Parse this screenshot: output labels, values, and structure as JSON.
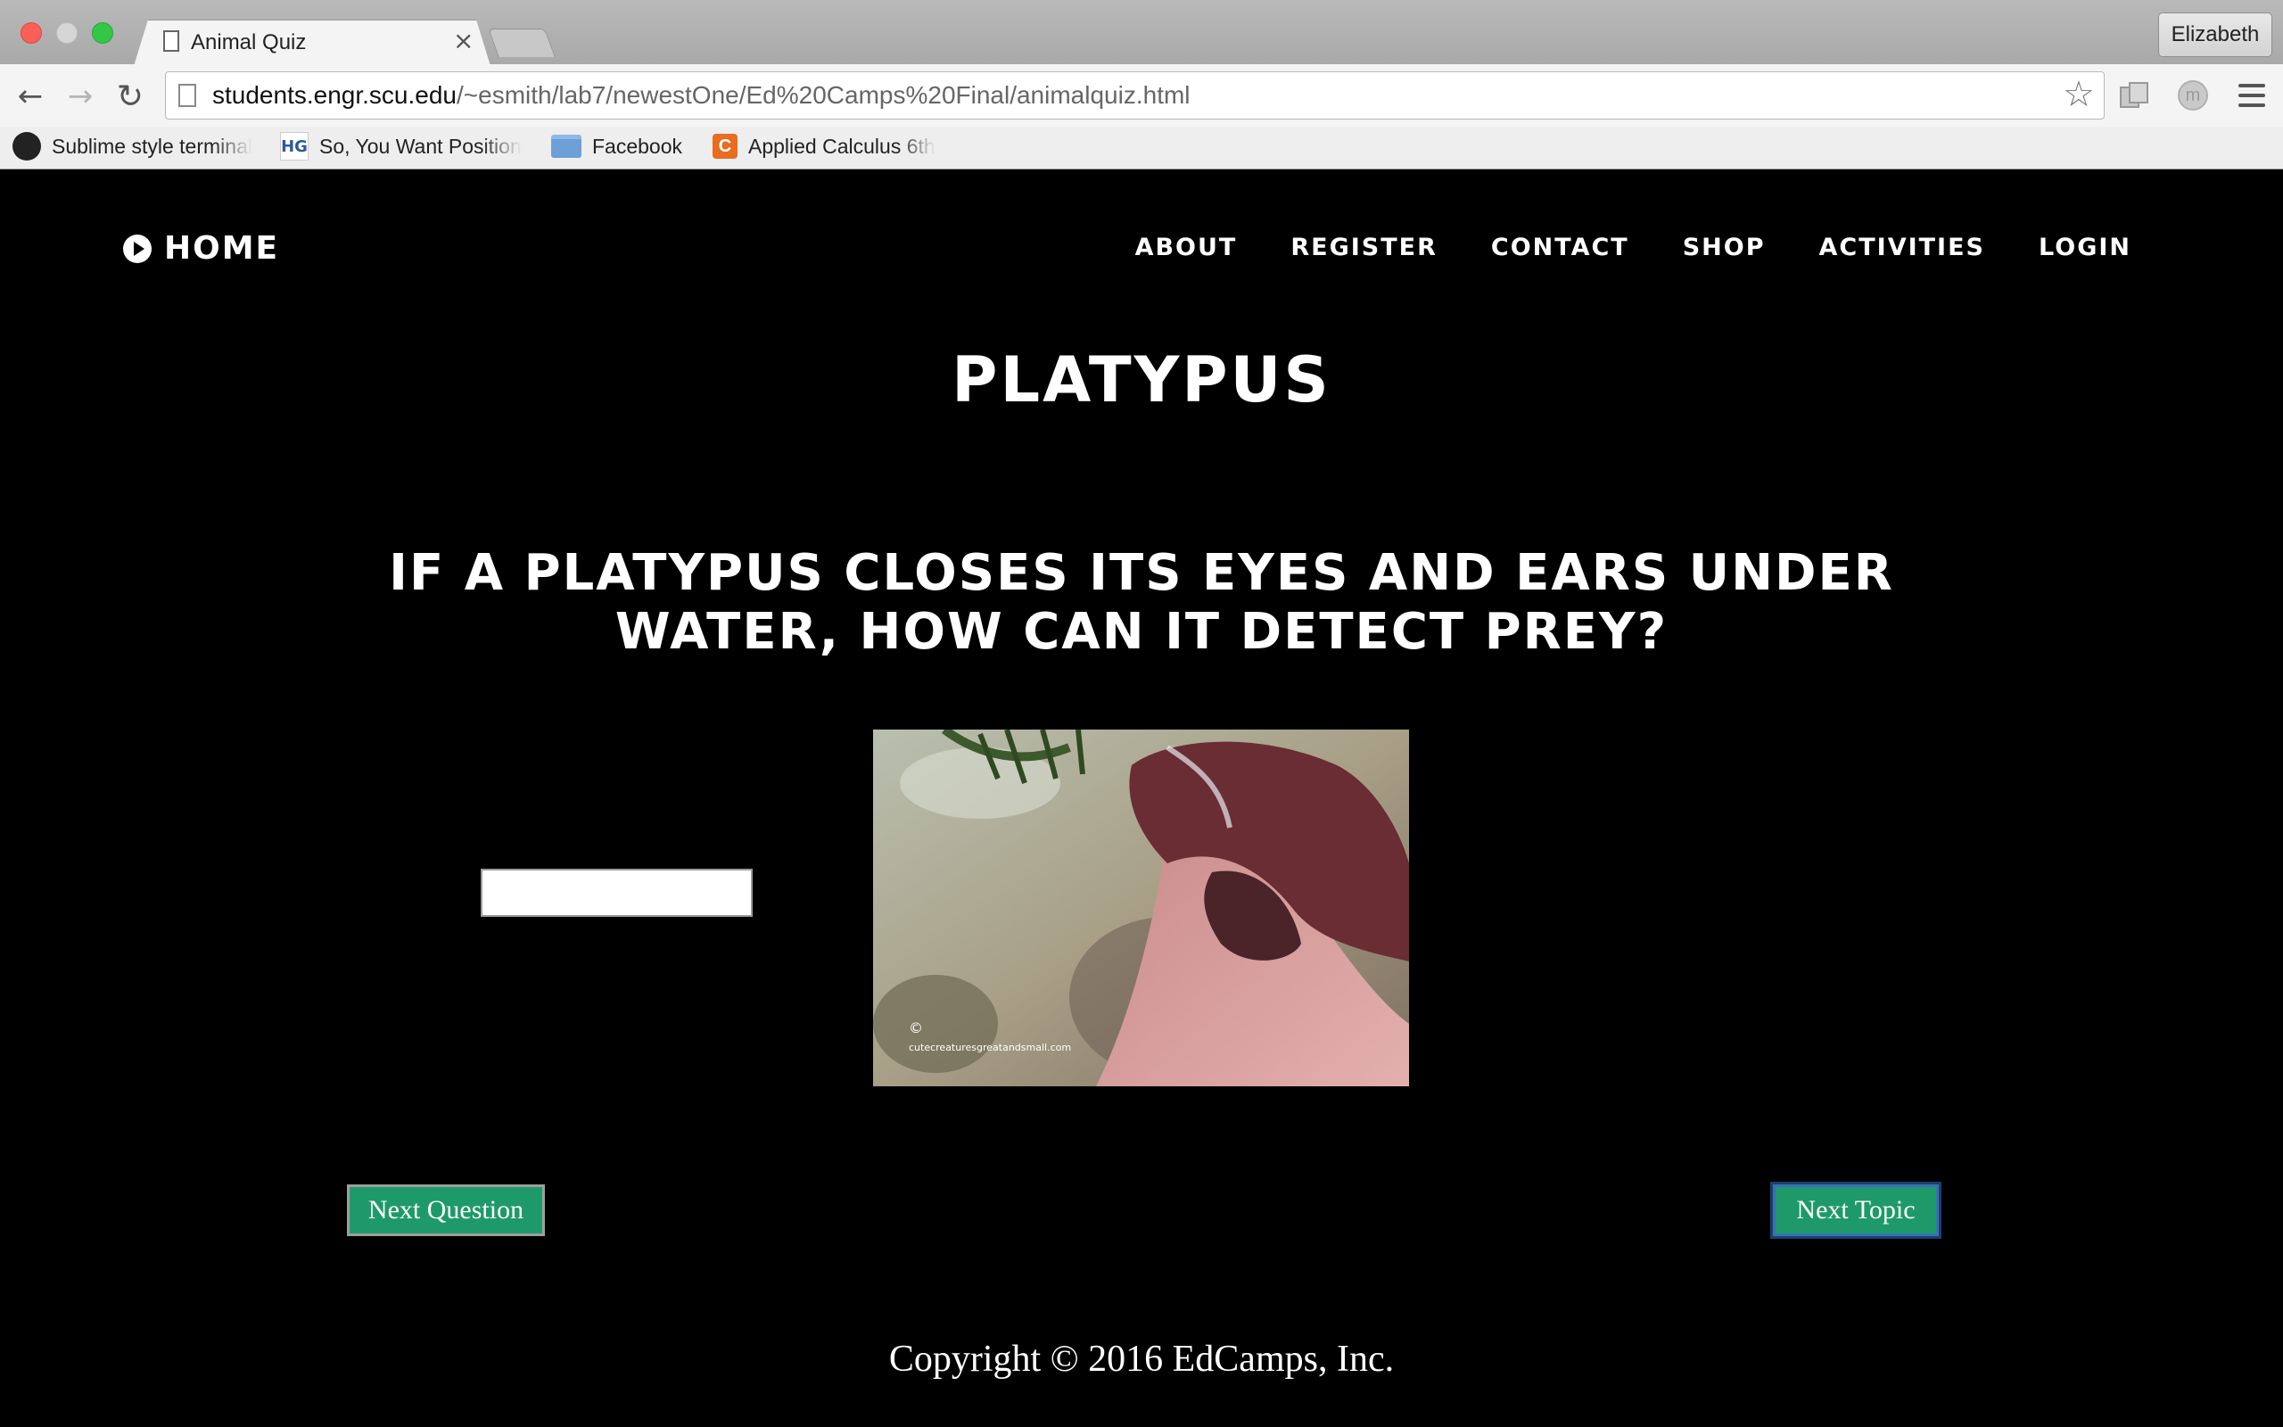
{
  "browser": {
    "tab": {
      "title": "Animal Quiz",
      "close_glyph": "×"
    },
    "profile_name": "Elizabeth",
    "url": {
      "host": "students.engr.scu.edu",
      "path": "/~esmith/lab7/newestOne/Ed%20Camps%20Final/animalquiz.html"
    },
    "nav_glyphs": {
      "back": "←",
      "forward": "→",
      "reload": "↻",
      "star": "☆"
    },
    "bookmarks": [
      {
        "label": "Sublime style terminal",
        "icon": "github-icon"
      },
      {
        "label": "So, You Want Position",
        "icon": "hg-icon",
        "icon_text": "HG"
      },
      {
        "label": "Facebook",
        "icon": "folder-icon"
      },
      {
        "label": "Applied Calculus 6th",
        "icon": "calc-icon",
        "icon_text": "C"
      }
    ]
  },
  "site": {
    "home_label": "HOME",
    "nav": [
      "ABOUT",
      "REGISTER",
      "CONTACT",
      "SHOP",
      "ACTIVITIES",
      "LOGIN"
    ]
  },
  "quiz": {
    "title": "PLATYPUS",
    "question": "IF A PLATYPUS CLOSES ITS EYES AND EARS UNDER WATER, HOW CAN IT DETECT PREY?",
    "answer_value": "",
    "image_caption": "cutecreaturesgreatandsmall.com",
    "image_copyright": "©",
    "next_question_label": "Next Question",
    "next_topic_label": "Next Topic"
  },
  "footer": {
    "copyright": "Copyright © 2016 EdCamps, Inc."
  },
  "colors": {
    "button_green": "#1e9a6a",
    "page_bg": "#000000",
    "focus_ring": "#3a6fb5"
  }
}
